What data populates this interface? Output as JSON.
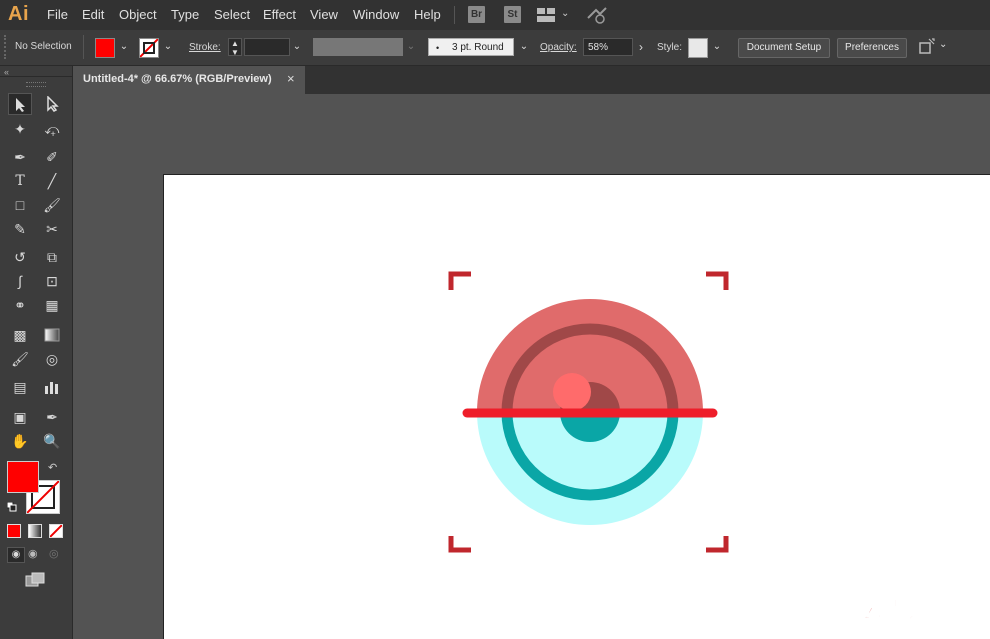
{
  "app": {
    "logo": "Ai"
  },
  "menu": [
    "File",
    "Edit",
    "Object",
    "Type",
    "Select",
    "Effect",
    "View",
    "Window",
    "Help"
  ],
  "menubar_buttons": {
    "bridge": "Br",
    "stock": "St"
  },
  "control": {
    "selection": "No Selection",
    "stroke_label": "Stroke:",
    "brush": "3 pt. Round",
    "opacity_label": "Opacity:",
    "opacity_value": "58%",
    "style_label": "Style:",
    "document_setup": "Document Setup",
    "preferences": "Preferences",
    "fill_color": "#ff0000"
  },
  "document_tab": {
    "title": "Untitled-4* @ 66.67% (RGB/Preview)",
    "close": "×"
  },
  "artwork": {
    "colors": {
      "upper_circle": "#e06b6b",
      "upper_ring": "#a04848",
      "lower_circle": "#b9fbfb",
      "lower_ring": "#0aa6a6",
      "pupil": "#0aa6a6",
      "highlight": "#ff6b6b",
      "scan_line": "#ee1e2a",
      "brackets": "#c0272d"
    }
  },
  "watermark": "云南龙网"
}
